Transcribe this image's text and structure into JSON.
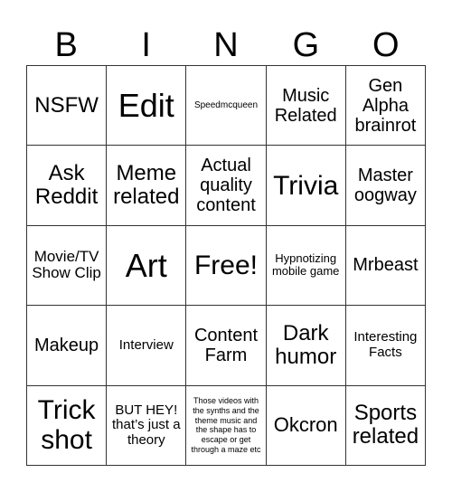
{
  "header": {
    "letters": [
      "B",
      "I",
      "N",
      "G",
      "O"
    ]
  },
  "grid": {
    "rows": [
      [
        "NSFW",
        "Edit",
        "Speedmcqueen",
        "Music Related",
        "Gen Alpha brainrot"
      ],
      [
        "Ask Reddit",
        "Meme related",
        "Actual quality content",
        "Trivia",
        "Master oogway"
      ],
      [
        "Movie/TV Show Clip",
        "Art",
        "Free!",
        "Hypnotizing mobile game",
        "Mrbeast"
      ],
      [
        "Makeup",
        "Interview",
        "Content Farm",
        "Dark humor",
        "Interesting Facts"
      ],
      [
        "Trick shot",
        "BUT HEY! that’s just a theory",
        "Those videos with the synths and the theme music and the shape has to escape or get through a maze etc",
        "Okcron",
        "Sports related"
      ]
    ],
    "free_space": "Free!"
  }
}
